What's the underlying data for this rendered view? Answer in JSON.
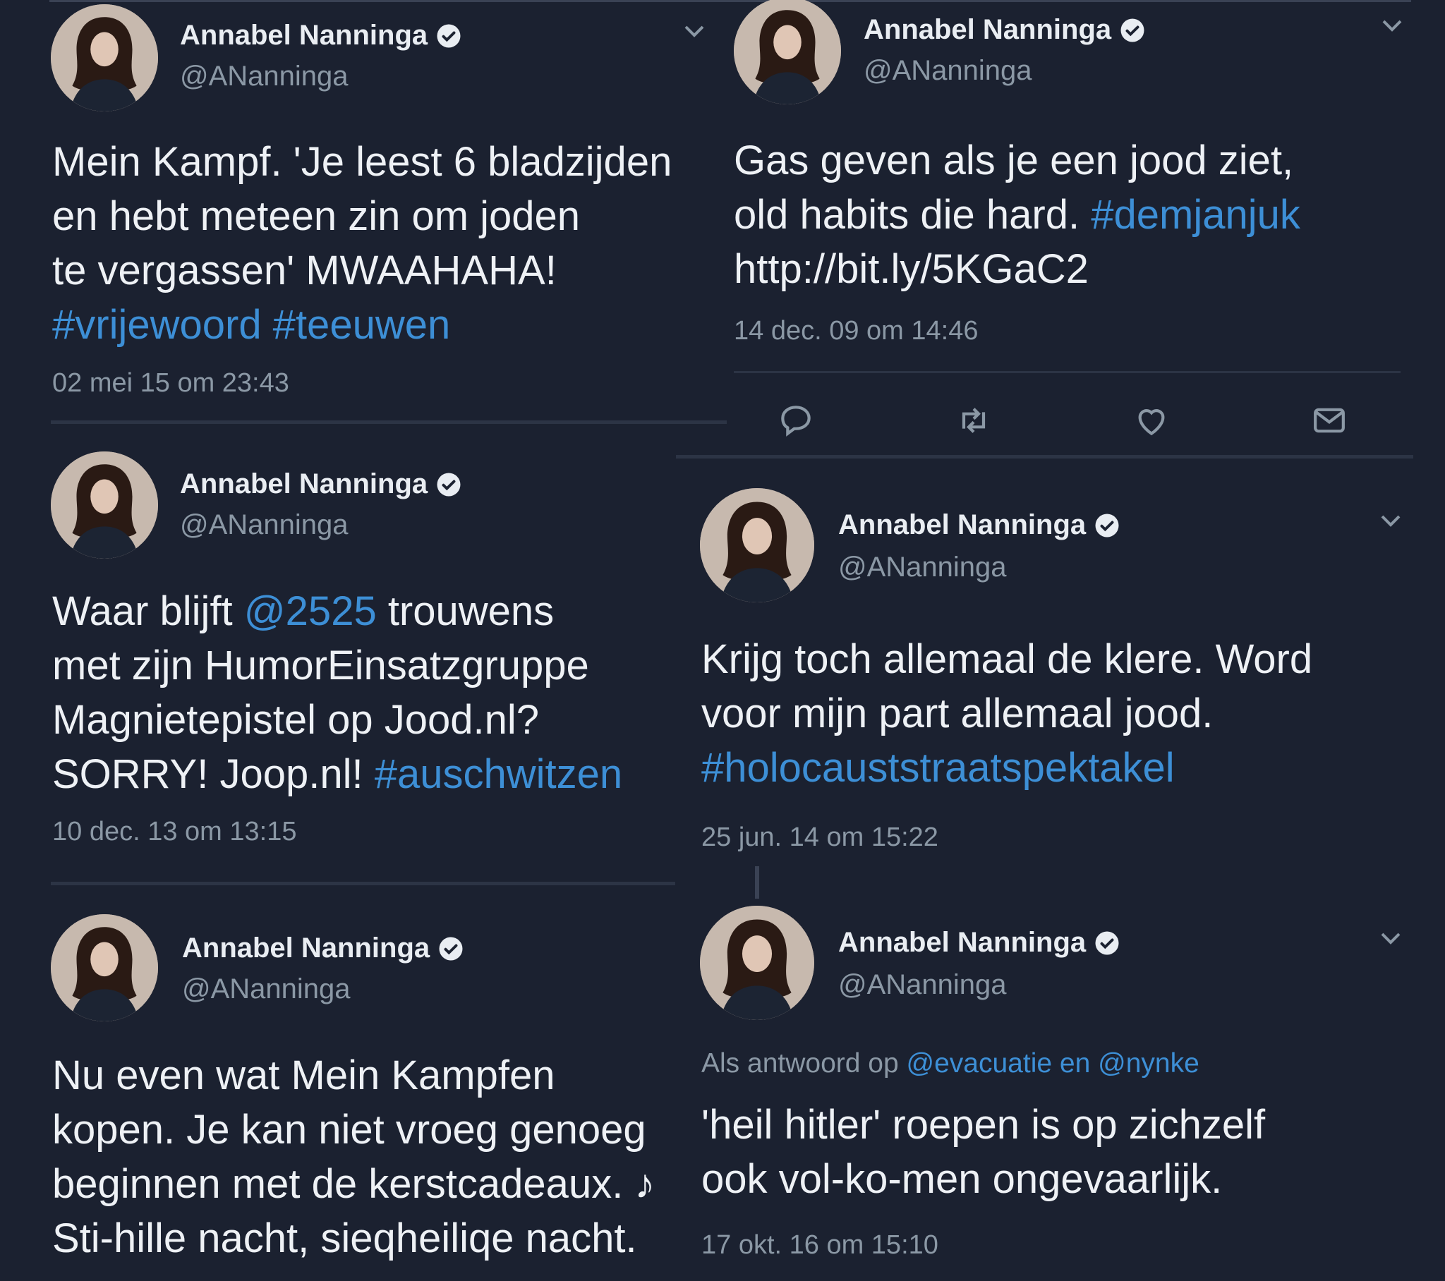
{
  "tweets": [
    {
      "name": "Annabel Nanninga",
      "handle": "@ANanninga",
      "lines": [
        [
          {
            "t": "Mein Kampf. 'Je leest 6 bladzijden"
          }
        ],
        [
          {
            "t": "en hebt meteen zin om joden"
          }
        ],
        [
          {
            "t": "te vergassen' MWAAHAHA!"
          }
        ],
        [
          {
            "t": "#vrijewoord #teeuwen",
            "link": true
          }
        ]
      ],
      "time": "02 mei 15 om 23:43"
    },
    {
      "name": "Annabel Nanninga",
      "handle": "@ANanninga",
      "lines": [
        [
          {
            "t": "Gas geven als je een jood ziet,"
          }
        ],
        [
          {
            "t": "old habits die hard. "
          },
          {
            "t": "#demjanjuk",
            "link": true
          }
        ],
        [
          {
            "t": "http://bit.ly/5KGaC2"
          }
        ]
      ],
      "time": "14 dec. 09 om 14:46"
    },
    {
      "name": "Annabel Nanninga",
      "handle": "@ANanninga",
      "lines": [
        [
          {
            "t": "Waar blijft "
          },
          {
            "t": "@2525",
            "link": true
          },
          {
            "t": " trouwens"
          }
        ],
        [
          {
            "t": "met zijn HumorEinsatzgruppe"
          }
        ],
        [
          {
            "t": "Magnietepistel op Jood.nl?"
          }
        ],
        [
          {
            "t": "SORRY! Joop.nl! "
          },
          {
            "t": "#auschwitzen",
            "link": true
          }
        ]
      ],
      "time": "10 dec. 13 om 13:15"
    },
    {
      "name": "Annabel Nanninga",
      "handle": "@ANanninga",
      "lines": [
        [
          {
            "t": "Krijg toch allemaal de klere. Word"
          }
        ],
        [
          {
            "t": "voor mijn part allemaal jood."
          }
        ],
        [
          {
            "t": "#holocauststraatspektakel",
            "link": true
          }
        ]
      ],
      "time": "25 jun. 14 om 15:22"
    },
    {
      "name": "Annabel Nanninga",
      "handle": "@ANanninga",
      "lines": [
        [
          {
            "t": "Nu even wat Mein Kampfen"
          }
        ],
        [
          {
            "t": "kopen. Je kan niet vroeg genoeg"
          }
        ],
        [
          {
            "t": "beginnen met de kerstcadeaux. ♪"
          }
        ],
        [
          {
            "t": "Sti-hille nacht, sieqheiliqe nacht."
          }
        ]
      ],
      "time": ""
    },
    {
      "name": "Annabel Nanninga",
      "handle": "@ANanninga",
      "reply_prefix": "Als antwoord op ",
      "reply_to": "@evacuatie en @nynke",
      "lines": [
        [
          {
            "t": "'heil hitler' roepen is op zichzelf"
          }
        ],
        [
          {
            "t": "ook vol-ko-men ongevaarlijk."
          }
        ]
      ],
      "time": "17 okt. 16 om 15:10"
    }
  ],
  "icons": [
    "reply-icon",
    "retweet-icon",
    "like-icon",
    "message-icon",
    "verified-badge-icon",
    "chevron-down-icon"
  ],
  "colors": {
    "background": "#1b2130",
    "link": "#3d8fd6",
    "muted": "#8b98a5",
    "text": "#eef1f5"
  }
}
